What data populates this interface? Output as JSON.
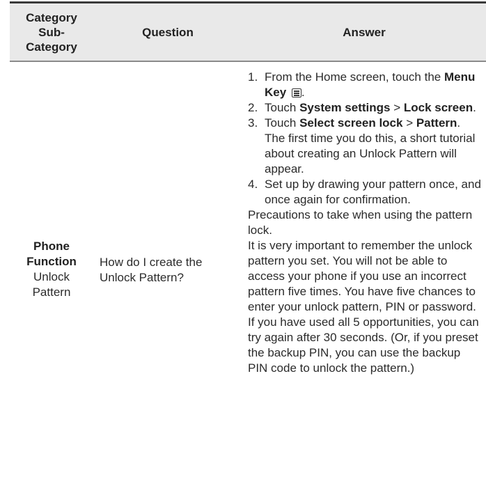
{
  "header": {
    "category": "Category",
    "subcategory": "Sub-Category",
    "question": "Question",
    "answer": "Answer"
  },
  "row": {
    "category": "Phone Function",
    "subcategory": "Unlock Pattern",
    "question": "How do I create the Unlock Pattern?",
    "steps": [
      {
        "num": "1.",
        "text_before": "From the Home screen, touch the ",
        "bold": "Menu Key",
        "icon": "menu-key-icon",
        "text_after": "."
      },
      {
        "num": "2.",
        "text_before": "Touch ",
        "bold": "System settings",
        "text_mid": " > ",
        "bold2": "Lock screen",
        "text_after": "."
      },
      {
        "num": "3.",
        "text_before": "Touch ",
        "bold": "Select screen lock",
        "text_mid": " > ",
        "bold2": "Pattern",
        "text_after": ". The first time you do this, a short tutorial about creating an Unlock Pattern will appear."
      },
      {
        "num": "4.",
        "text_before": "Set up by drawing your pattern once, and once again for confirmation."
      }
    ],
    "paragraphs": [
      "Precautions to take when using the pattern lock.",
      "It is very important to remember the unlock pattern you set. You will not be able to access your phone if you use an incorrect pattern five times. You have five chances to enter your unlock pattern, PIN or password. If you have used all 5 opportunities, you can try again after 30 seconds. (Or, if you preset the backup PIN, you can use the backup PIN code to unlock the pattern.)"
    ]
  }
}
